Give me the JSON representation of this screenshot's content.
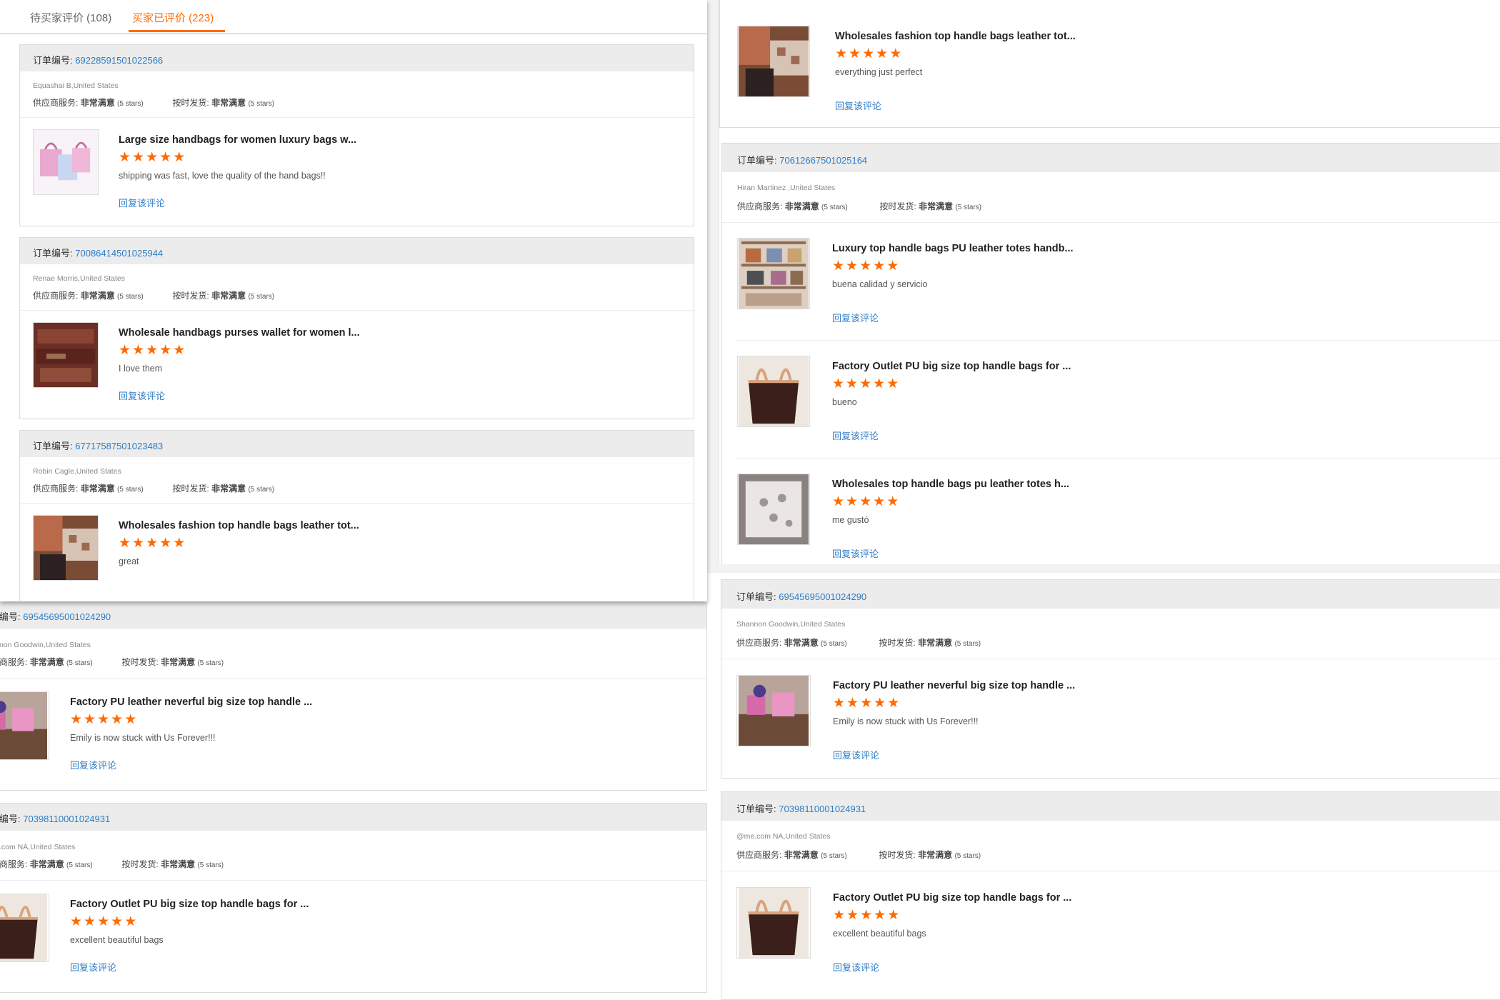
{
  "tabs": {
    "pending_label": "待买家评价 (108)",
    "reviewed_label": "买家已评价 (223)"
  },
  "labels": {
    "order_no": "订单编号:",
    "order_no_cut": "编号:",
    "supplier_service": "供应商服务:",
    "supplier_service_cut": "商服务:",
    "on_time": "按时发货:",
    "very_satisfied": "非常满意",
    "five_stars": "(5 stars)",
    "reply": "回复该评论"
  },
  "star_glyph": "★",
  "colors": {
    "accent": "#ff6a00",
    "link": "#2d7cc7",
    "header_bg": "#ececec"
  },
  "reviews_left": [
    {
      "order_no": "69228591501022566",
      "buyer": "Equashai B,United States",
      "item": {
        "title": "Large size handbags for women luxury bags w...",
        "comment": "shipping was fast, love the quality of the hand bags!!",
        "rating": 5,
        "thumb": "pink-handbags"
      }
    },
    {
      "order_no": "70086414501025944",
      "buyer": "Renae Morris,United States",
      "item": {
        "title": "Wholesale handbags purses wallet for women l...",
        "comment": "I love them",
        "rating": 5,
        "thumb": "brown-wallets"
      }
    },
    {
      "order_no": "67717587501023483",
      "buyer": "Robin Cagle,United States",
      "item": {
        "title": "Wholesales fashion top handle bags leather tot...",
        "comment": "great",
        "rating": 5,
        "thumb": "checkered-bag"
      }
    }
  ],
  "reviews_left_lower": [
    {
      "order_no": "69545695001024290",
      "buyer": "non Goodwin,United States",
      "item": {
        "title": "Factory PU leather neverful big size top handle ...",
        "comment": "Emily is now stuck with Us Forever!!!",
        "rating": 5,
        "thumb": "pink-bags-room"
      }
    },
    {
      "order_no": "70398110001024931",
      "buyer": ".com NA,United States",
      "item": {
        "title": "Factory Outlet PU big size top handle bags for ...",
        "comment": "excellent beautiful bags",
        "rating": 5,
        "thumb": "brown-tote"
      }
    }
  ],
  "reviews_right": [
    {
      "order_no": null,
      "buyer": null,
      "item": {
        "title": "Wholesales fashion top handle bags leather tot...",
        "comment": "everything just perfect",
        "rating": 5,
        "thumb": "checkered-bag"
      }
    },
    {
      "order_no": "70612667501025164",
      "buyer": "Hiran Martinez ,United States",
      "items": [
        {
          "title": "Luxury top handle bags PU leather totes handb...",
          "comment": "buena calidad y servicio",
          "rating": 5,
          "thumb": "bags-shelf"
        },
        {
          "title": "Factory Outlet PU big size top handle bags for ...",
          "comment": "bueno",
          "rating": 5,
          "thumb": "brown-tote"
        },
        {
          "title": "Wholesales top handle bags pu leather totes h...",
          "comment": "me gustó",
          "rating": 5,
          "thumb": "white-bag"
        }
      ]
    }
  ],
  "reviews_right_lower": [
    {
      "order_no": "69545695001024290",
      "buyer": "Shannon Goodwin,United States",
      "item": {
        "title": "Factory PU leather neverful big size top handle ...",
        "comment": "Emily is now stuck with Us Forever!!!",
        "rating": 5,
        "thumb": "pink-bags-room"
      }
    },
    {
      "order_no": "70398110001024931",
      "buyer": "@me.com NA,United States",
      "item": {
        "title": "Factory Outlet PU big size top handle bags for ...",
        "comment": "excellent beautiful bags",
        "rating": 5,
        "thumb": "brown-tote"
      }
    }
  ]
}
